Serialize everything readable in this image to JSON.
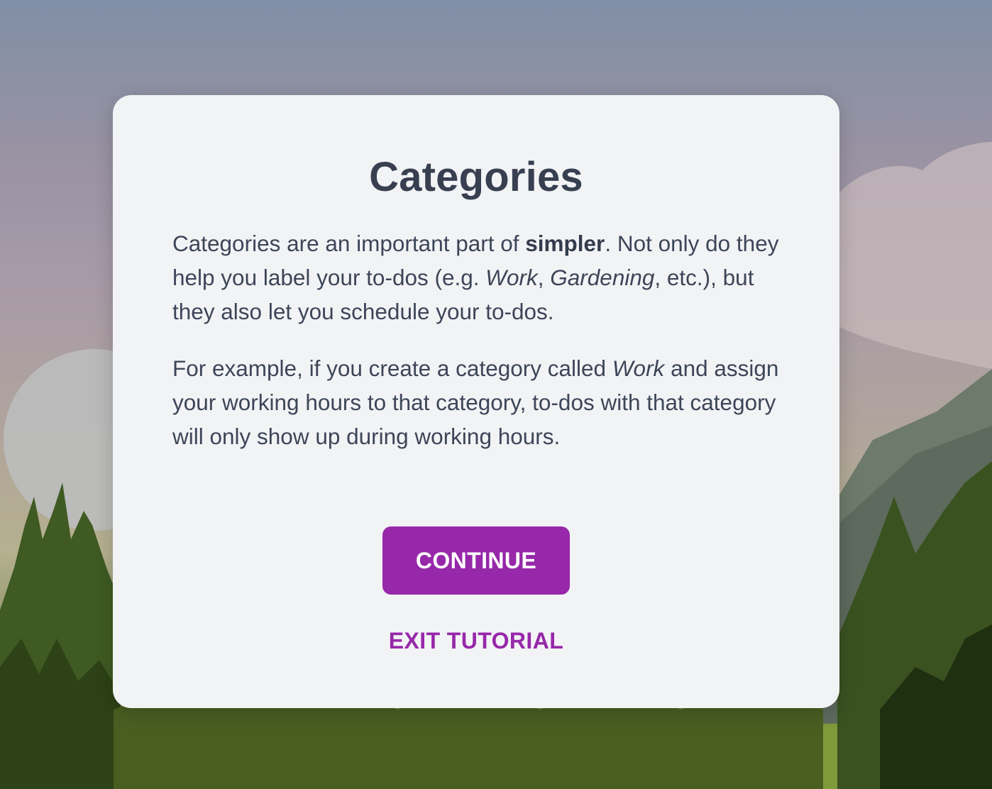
{
  "modal": {
    "title": "Categories",
    "paragraph1": {
      "part1": "Categories are an important part of ",
      "bold": "simpler",
      "part2": ". Not only do they help you label your to-dos (e.g. ",
      "italic1": "Work",
      "part3": ", ",
      "italic2": "Gardening",
      "part4": ", etc.), but they also let you schedule your to-dos."
    },
    "paragraph2": {
      "part1": "For example, if you create a category called ",
      "italic": "Work",
      "part2": " and assign your working hours to that category, to-dos with that category will only show up during working hours."
    },
    "continue_label": "CONTINUE",
    "exit_label": "EXIT TUTORIAL"
  },
  "colors": {
    "accent": "#9628a9",
    "modal_background": "#f2f3f5",
    "heading_text": "#373f51",
    "body_text": "#3d4558"
  }
}
